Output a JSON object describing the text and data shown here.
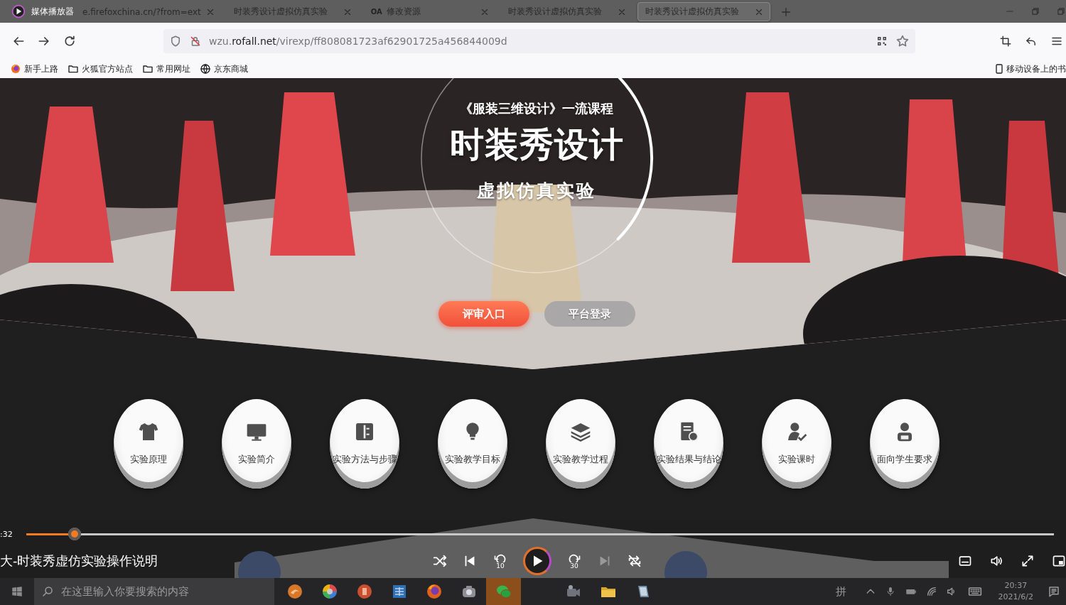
{
  "player": {
    "app_title": "媒体播放器",
    "video_title": "大-时装秀虚仿实验操作说明",
    "position": ":32",
    "level": 0.047,
    "playing": false,
    "skip_back": "10",
    "skip_forward": "30"
  },
  "browser": {
    "tabs": [
      {
        "label": "e.firefoxchina.cn/?from=ext",
        "selected": false
      },
      {
        "label": "时装秀设计虚拟仿真实验",
        "selected": false
      },
      {
        "label": "修改资源",
        "badge": "OA",
        "selected": false
      },
      {
        "label": "时装秀设计虚拟仿真实验",
        "selected": false
      },
      {
        "label": "时装秀设计虚拟仿真实验",
        "selected": true
      }
    ],
    "url": {
      "subdomain": "wzu.",
      "domain": "rofall.net",
      "path": "/virexp/ff808081723af62901725a456844009d"
    },
    "bookmarks": [
      {
        "label": "新手上路",
        "kind": "firefox"
      },
      {
        "label": "火狐官方站点",
        "kind": "folder"
      },
      {
        "label": "常用网址",
        "kind": "folder"
      },
      {
        "label": "京东商城",
        "kind": "globe"
      }
    ],
    "mobile_bookmarks": "移动设备上的书"
  },
  "hero": {
    "course": "《服装三维设计》一流课程",
    "title": "时装秀设计",
    "subtitle": "虚拟仿真实验",
    "buttons": [
      {
        "label": "评审入口",
        "kind": "primary"
      },
      {
        "label": "平台登录",
        "kind": "secondary"
      }
    ]
  },
  "modules": [
    {
      "label": "实验原理",
      "kind": "shirt"
    },
    {
      "label": "实验简介",
      "kind": "monitor"
    },
    {
      "label": "实验方法与步骤",
      "kind": "panel"
    },
    {
      "label": "实验教学目标",
      "kind": "bulb"
    },
    {
      "label": "实验教学过程",
      "kind": "layers"
    },
    {
      "label": "实验结果与结论",
      "kind": "document"
    },
    {
      "label": "实验课时",
      "kind": "user-check"
    },
    {
      "label": "面向学生要求",
      "kind": "user"
    }
  ],
  "taskbar": {
    "search_placeholder": "在这里输入你要搜索的内容",
    "apps": [
      {
        "kind": "ball",
        "highlighted": false
      },
      {
        "kind": "wheel",
        "highlighted": false
      },
      {
        "kind": "slides",
        "highlighted": false
      },
      {
        "kind": "window",
        "highlighted": false
      },
      {
        "kind": "firefox",
        "highlighted": false
      },
      {
        "kind": "camera",
        "highlighted": false
      },
      {
        "kind": "chat",
        "highlighted": true
      },
      {
        "kind": "camcorder",
        "highlighted": false
      },
      {
        "kind": "folder",
        "highlighted": false
      },
      {
        "kind": "notebook",
        "highlighted": false
      }
    ],
    "ime": "拼",
    "time": "20:37",
    "date": "2021/6/2"
  }
}
